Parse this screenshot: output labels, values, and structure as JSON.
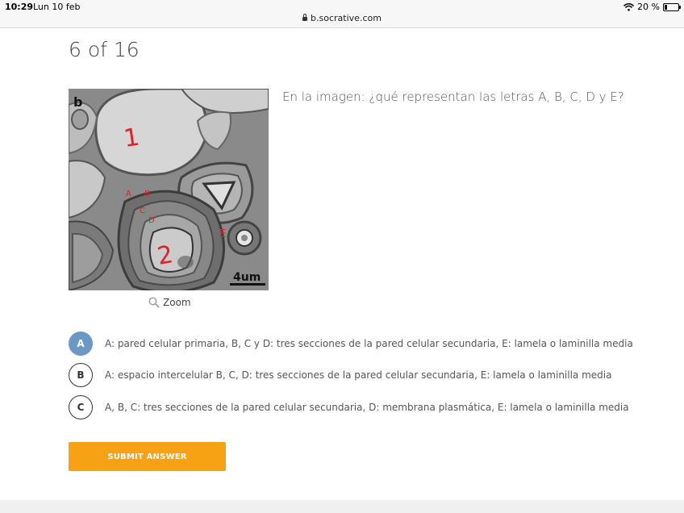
{
  "status_bar": {
    "time": "10:29",
    "date": "Lun 10 feb",
    "url": "b.socrative.com",
    "battery": "20 %"
  },
  "progress": "6 of 16",
  "image": {
    "panel_letter": "b",
    "annotations": [
      "1",
      "2",
      "A",
      "B",
      "C",
      "D",
      "E"
    ],
    "scale_label": "4um"
  },
  "zoom_label": "Zoom",
  "question": "En la imagen: ¿qué representan las letras A, B, C, D y E?",
  "answers": [
    {
      "letter": "A",
      "text": "A: pared celular primaria, B, C y D: tres secciones de la pared celular secundaria, E: lamela o laminilla media"
    },
    {
      "letter": "B",
      "text": "A: espacio intercelular B, C, D: tres secciones de la pared celular secundaria, E: lamela o laminilla media"
    },
    {
      "letter": "C",
      "text": "A, B, C: tres secciones de la pared celular secundaria, D: membrana plasmática, E: lamela o laminilla media"
    }
  ],
  "submit_label": "SUBMIT ANSWER",
  "colors": {
    "submit": "#f7a114",
    "selected_answer": "#6b98c6",
    "annotation_ink": "#e0202a"
  }
}
